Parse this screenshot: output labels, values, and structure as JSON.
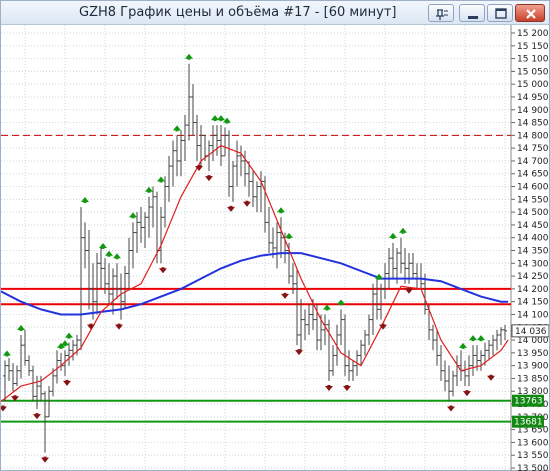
{
  "window": {
    "title": "GZH8 График цены и объёма #17 - [60 минут]",
    "buttons": [
      "pin",
      "minimize",
      "maximize",
      "close"
    ]
  },
  "chart_data": {
    "type": "candlestick",
    "title": "GZH8 График цены и объёма #17 - [60 минут]",
    "timeframe": "60 минут",
    "y_axis": {
      "min": 13500,
      "max": 15200,
      "ticks": [
        15200,
        15150,
        15100,
        15050,
        15000,
        14950,
        14900,
        14850,
        14800,
        14750,
        14700,
        14650,
        14600,
        14550,
        14500,
        14450,
        14400,
        14350,
        14300,
        14250,
        14200,
        14150,
        14100,
        14050,
        14000,
        13950,
        13900,
        13850,
        13800,
        13750,
        13700,
        13650,
        13600,
        13550,
        13500
      ],
      "tick_labels": [
        "15 200",
        "15 150",
        "15 100",
        "15 050",
        "15 000",
        "14 950",
        "14 900",
        "14 850",
        "14 800",
        "14 750",
        "14 700",
        "14 650",
        "14 600",
        "14 550",
        "14 500",
        "14 450",
        "14 400",
        "14 350",
        "14 300",
        "14 250",
        "14 200",
        "14 150",
        "14 100",
        "14 050",
        "14 000",
        "13 950",
        "13 900",
        "13 850",
        "13 800",
        "13 750",
        "13 700",
        "13 650",
        "13 600",
        "13 550",
        "13 500"
      ]
    },
    "grid": true,
    "price_marker": {
      "value": 14036,
      "label": "14 036"
    },
    "horizontal_levels": [
      {
        "value": 14800,
        "color": "#cc0000",
        "style": "dashed"
      },
      {
        "value": 14200,
        "color": "#ee0000",
        "style": "solid"
      },
      {
        "value": 14140,
        "color": "#ee0000",
        "style": "solid"
      },
      {
        "value": 13763,
        "color": "#119911",
        "style": "solid",
        "label": "13763"
      },
      {
        "value": 13681,
        "color": "#119911",
        "style": "solid",
        "label": "13681"
      }
    ],
    "moving_average_long": {
      "color": "#2233dd",
      "points": [
        [
          0,
          14190
        ],
        [
          20,
          14150
        ],
        [
          40,
          14120
        ],
        [
          60,
          14100
        ],
        [
          80,
          14100
        ],
        [
          100,
          14110
        ],
        [
          120,
          14120
        ],
        [
          140,
          14140
        ],
        [
          160,
          14170
        ],
        [
          180,
          14200
        ],
        [
          200,
          14240
        ],
        [
          220,
          14280
        ],
        [
          240,
          14310
        ],
        [
          260,
          14330
        ],
        [
          280,
          14340
        ],
        [
          300,
          14340
        ],
        [
          320,
          14320
        ],
        [
          340,
          14300
        ],
        [
          360,
          14270
        ],
        [
          380,
          14240
        ],
        [
          400,
          14240
        ],
        [
          420,
          14240
        ],
        [
          440,
          14230
        ],
        [
          460,
          14200
        ],
        [
          480,
          14170
        ],
        [
          500,
          14150
        ],
        [
          507,
          14150
        ]
      ]
    },
    "moving_average_short": {
      "color": "#e02020",
      "points": [
        [
          0,
          13760
        ],
        [
          20,
          13820
        ],
        [
          40,
          13840
        ],
        [
          60,
          13900
        ],
        [
          80,
          13970
        ],
        [
          100,
          14110
        ],
        [
          120,
          14180
        ],
        [
          140,
          14220
        ],
        [
          160,
          14370
        ],
        [
          180,
          14560
        ],
        [
          200,
          14700
        ],
        [
          220,
          14760
        ],
        [
          240,
          14730
        ],
        [
          260,
          14620
        ],
        [
          280,
          14430
        ],
        [
          300,
          14240
        ],
        [
          320,
          14080
        ],
        [
          340,
          13950
        ],
        [
          360,
          13900
        ],
        [
          380,
          14050
        ],
        [
          400,
          14210
        ],
        [
          420,
          14200
        ],
        [
          440,
          14000
        ],
        [
          460,
          13880
        ],
        [
          480,
          13900
        ],
        [
          500,
          13960
        ],
        [
          507,
          14000
        ]
      ]
    },
    "bars": [
      [
        4,
        13760,
        13920,
        13860,
        13900
      ],
      [
        8,
        13840,
        13930,
        13900,
        13880
      ],
      [
        12,
        13800,
        13910,
        13880,
        13830
      ],
      [
        16,
        13820,
        13900,
        13830,
        13880
      ],
      [
        20,
        13850,
        14020,
        13880,
        13980
      ],
      [
        24,
        13900,
        14040,
        13980,
        13920
      ],
      [
        28,
        13860,
        13940,
        13920,
        13880
      ],
      [
        32,
        13760,
        13900,
        13880,
        13780
      ],
      [
        36,
        13730,
        13860,
        13780,
        13820
      ],
      [
        40,
        13760,
        13860,
        13820,
        13790
      ],
      [
        44,
        13560,
        13800,
        13790,
        13700
      ],
      [
        48,
        13700,
        13820,
        13700,
        13800
      ],
      [
        52,
        13780,
        13890,
        13800,
        13860
      ],
      [
        56,
        13830,
        13960,
        13860,
        13920
      ],
      [
        60,
        13880,
        13950,
        13920,
        13900
      ],
      [
        64,
        13860,
        13960,
        13900,
        13940
      ],
      [
        68,
        13900,
        13990,
        13940,
        13960
      ],
      [
        72,
        13920,
        14000,
        13960,
        13980
      ],
      [
        76,
        13940,
        14020,
        13980,
        14000
      ],
      [
        80,
        13960,
        14520,
        14000,
        14400
      ],
      [
        84,
        14280,
        14460,
        14400,
        14350
      ],
      [
        88,
        14120,
        14430,
        14350,
        14200
      ],
      [
        92,
        14080,
        14300,
        14200,
        14150
      ],
      [
        96,
        14100,
        14340,
        14150,
        14300
      ],
      [
        100,
        14200,
        14360,
        14300,
        14280
      ],
      [
        104,
        14180,
        14320,
        14280,
        14220
      ],
      [
        108,
        14140,
        14300,
        14220,
        14180
      ],
      [
        112,
        14100,
        14280,
        14180,
        14250
      ],
      [
        116,
        14160,
        14300,
        14250,
        14200
      ],
      [
        120,
        14080,
        14260,
        14200,
        14150
      ],
      [
        124,
        14120,
        14290,
        14150,
        14260
      ],
      [
        128,
        14200,
        14400,
        14260,
        14350
      ],
      [
        132,
        14280,
        14460,
        14350,
        14420
      ],
      [
        136,
        14340,
        14500,
        14420,
        14460
      ],
      [
        140,
        14380,
        14520,
        14460,
        14440
      ],
      [
        144,
        14360,
        14500,
        14440,
        14480
      ],
      [
        148,
        14400,
        14560,
        14480,
        14520
      ],
      [
        152,
        14440,
        14600,
        14520,
        14560
      ],
      [
        156,
        14300,
        14580,
        14560,
        14350
      ],
      [
        160,
        14300,
        14520,
        14350,
        14480
      ],
      [
        164,
        14440,
        14640,
        14480,
        14600
      ],
      [
        168,
        14540,
        14720,
        14600,
        14680
      ],
      [
        172,
        14600,
        14780,
        14680,
        14740
      ],
      [
        176,
        14640,
        14800,
        14740,
        14700
      ],
      [
        180,
        14640,
        14820,
        14700,
        14780
      ],
      [
        184,
        14700,
        14880,
        14780,
        14840
      ],
      [
        188,
        14780,
        15080,
        14840,
        14950
      ],
      [
        192,
        14800,
        15000,
        14950,
        14850
      ],
      [
        196,
        14700,
        14880,
        14850,
        14760
      ],
      [
        200,
        14680,
        14840,
        14760,
        14800
      ],
      [
        204,
        14700,
        14800,
        14800,
        14720
      ],
      [
        208,
        14660,
        14780,
        14720,
        14760
      ],
      [
        212,
        14700,
        14840,
        14760,
        14800
      ],
      [
        216,
        14720,
        14840,
        14800,
        14780
      ],
      [
        220,
        14680,
        14840,
        14780,
        14720
      ],
      [
        224,
        14720,
        14830,
        14720,
        14800
      ],
      [
        228,
        14560,
        14820,
        14800,
        14600
      ],
      [
        232,
        14540,
        14700,
        14600,
        14680
      ],
      [
        236,
        14600,
        14780,
        14680,
        14720
      ],
      [
        240,
        14640,
        14760,
        14720,
        14700
      ],
      [
        244,
        14600,
        14740,
        14700,
        14650
      ],
      [
        248,
        14560,
        14700,
        14650,
        14620
      ],
      [
        252,
        14520,
        14660,
        14620,
        14560
      ],
      [
        256,
        14500,
        14620,
        14560,
        14600
      ],
      [
        260,
        14500,
        14660,
        14600,
        14620
      ],
      [
        264,
        14420,
        14640,
        14620,
        14460
      ],
      [
        268,
        14340,
        14520,
        14460,
        14380
      ],
      [
        272,
        14320,
        14440,
        14380,
        14360
      ],
      [
        276,
        14280,
        14460,
        14360,
        14420
      ],
      [
        280,
        14320,
        14480,
        14420,
        14400
      ],
      [
        284,
        14300,
        14420,
        14400,
        14350
      ],
      [
        288,
        14220,
        14380,
        14350,
        14250
      ],
      [
        292,
        14180,
        14300,
        14250,
        14220
      ],
      [
        296,
        13980,
        14280,
        14220,
        14020
      ],
      [
        300,
        13960,
        14160,
        14020,
        14080
      ],
      [
        304,
        14000,
        14120,
        14080,
        14060
      ],
      [
        308,
        14020,
        14140,
        14060,
        14100
      ],
      [
        312,
        14040,
        14160,
        14100,
        14080
      ],
      [
        316,
        13960,
        14140,
        14080,
        14000
      ],
      [
        320,
        13960,
        14100,
        14000,
        14040
      ],
      [
        324,
        13980,
        14100,
        14040,
        14060
      ],
      [
        328,
        13840,
        14080,
        14060,
        13880
      ],
      [
        332,
        13860,
        13980,
        13880,
        13940
      ],
      [
        336,
        13900,
        14060,
        13940,
        14020
      ],
      [
        340,
        13980,
        14120,
        14020,
        14080
      ],
      [
        344,
        13860,
        14100,
        14080,
        13900
      ],
      [
        348,
        13840,
        13960,
        13900,
        13880
      ],
      [
        352,
        13840,
        13920,
        13880,
        13900
      ],
      [
        356,
        13860,
        13960,
        13900,
        13940
      ],
      [
        360,
        13900,
        14000,
        13940,
        13980
      ],
      [
        364,
        13940,
        14040,
        13980,
        14020
      ],
      [
        368,
        13980,
        14100,
        14020,
        14080
      ],
      [
        372,
        14020,
        14220,
        14080,
        14180
      ],
      [
        376,
        14080,
        14240,
        14180,
        14120
      ],
      [
        380,
        14080,
        14220,
        14120,
        14200
      ],
      [
        384,
        14160,
        14300,
        14200,
        14260
      ],
      [
        388,
        14200,
        14360,
        14260,
        14320
      ],
      [
        392,
        14240,
        14380,
        14320,
        14280
      ],
      [
        396,
        14220,
        14360,
        14280,
        14340
      ],
      [
        400,
        14260,
        14400,
        14340,
        14300
      ],
      [
        404,
        14220,
        14360,
        14300,
        14280
      ],
      [
        408,
        14220,
        14340,
        14280,
        14300
      ],
      [
        412,
        14240,
        14340,
        14300,
        14260
      ],
      [
        416,
        14200,
        14300,
        14260,
        14240
      ],
      [
        420,
        14200,
        14300,
        14240,
        14220
      ],
      [
        424,
        14100,
        14260,
        14220,
        14120
      ],
      [
        428,
        14000,
        14140,
        14120,
        14040
      ],
      [
        432,
        13960,
        14060,
        14040,
        14000
      ],
      [
        436,
        13900,
        14040,
        14000,
        13940
      ],
      [
        440,
        13840,
        13980,
        13940,
        13880
      ],
      [
        444,
        13800,
        13920,
        13880,
        13840
      ],
      [
        448,
        13760,
        13900,
        13840,
        13800
      ],
      [
        452,
        13780,
        13880,
        13800,
        13860
      ],
      [
        456,
        13820,
        13940,
        13860,
        13900
      ],
      [
        460,
        13840,
        13960,
        13900,
        13880
      ],
      [
        464,
        13820,
        13920,
        13880,
        13860
      ],
      [
        468,
        13820,
        13940,
        13860,
        13900
      ],
      [
        472,
        13860,
        13980,
        13900,
        13940
      ],
      [
        476,
        13880,
        13980,
        13940,
        13920
      ],
      [
        480,
        13880,
        13960,
        13920,
        13940
      ],
      [
        484,
        13900,
        13990,
        13940,
        13960
      ],
      [
        488,
        13920,
        14000,
        13960,
        13980
      ],
      [
        492,
        13940,
        14020,
        13980,
        14000
      ],
      [
        496,
        13960,
        14040,
        14000,
        14020
      ],
      [
        500,
        13980,
        14050,
        14020,
        14040
      ],
      [
        504,
        14000,
        14060,
        14040,
        14036
      ]
    ],
    "up_markers": [
      [
        6,
        13920
      ],
      [
        20,
        14020
      ],
      [
        60,
        13950
      ],
      [
        64,
        13960
      ],
      [
        68,
        13990
      ],
      [
        84,
        14520
      ],
      [
        102,
        14340
      ],
      [
        108,
        14310
      ],
      [
        116,
        14300
      ],
      [
        132,
        14460
      ],
      [
        148,
        14560
      ],
      [
        160,
        14600
      ],
      [
        176,
        14800
      ],
      [
        188,
        15080
      ],
      [
        214,
        14840
      ],
      [
        220,
        14840
      ],
      [
        226,
        14830
      ],
      [
        280,
        14480
      ],
      [
        288,
        14380
      ],
      [
        326,
        14100
      ],
      [
        340,
        14120
      ],
      [
        378,
        14220
      ],
      [
        392,
        14380
      ],
      [
        402,
        14400
      ],
      [
        462,
        13950
      ],
      [
        472,
        13980
      ],
      [
        480,
        13980
      ]
    ],
    "down_markers": [
      [
        2,
        13760
      ],
      [
        14,
        13800
      ],
      [
        36,
        13730
      ],
      [
        44,
        13560
      ],
      [
        66,
        13860
      ],
      [
        90,
        14080
      ],
      [
        118,
        14080
      ],
      [
        162,
        14300
      ],
      [
        198,
        14700
      ],
      [
        208,
        14660
      ],
      [
        230,
        14540
      ],
      [
        246,
        14560
      ],
      [
        284,
        14200
      ],
      [
        298,
        13980
      ],
      [
        328,
        13840
      ],
      [
        346,
        13840
      ],
      [
        382,
        14080
      ],
      [
        408,
        14220
      ],
      [
        450,
        13760
      ],
      [
        466,
        13820
      ],
      [
        490,
        13880
      ]
    ]
  }
}
